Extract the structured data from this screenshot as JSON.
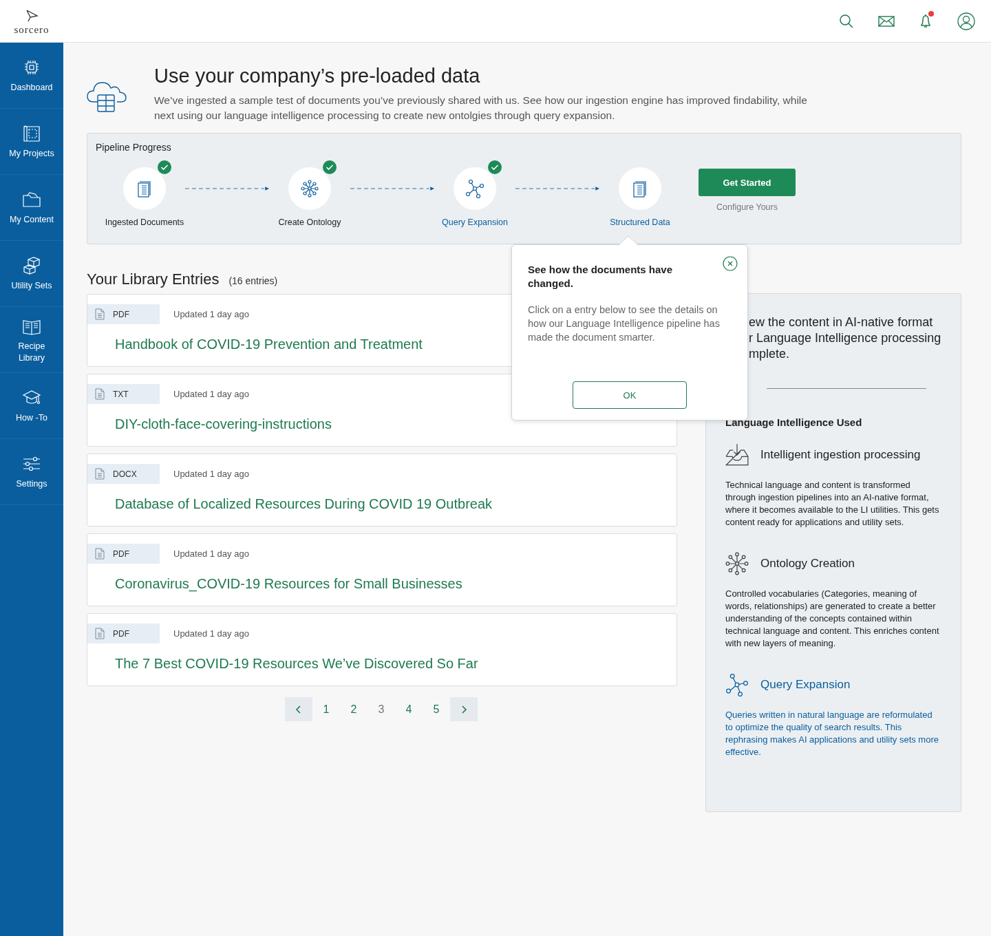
{
  "brand": {
    "name": "sorcero"
  },
  "header_icons": [
    {
      "kind": "search",
      "badge": false
    },
    {
      "kind": "mail",
      "badge": false
    },
    {
      "kind": "bell",
      "badge": true
    },
    {
      "kind": "user",
      "badge": false
    }
  ],
  "sidebar": {
    "items": [
      {
        "label": "Dashboard",
        "kind": "chip"
      },
      {
        "label": "My Projects",
        "kind": "blueprint"
      },
      {
        "label": "My Content",
        "kind": "folder"
      },
      {
        "label": "Utility Sets",
        "kind": "blocks"
      },
      {
        "label": "Recipe Library",
        "kind": "book"
      },
      {
        "label": "How -To",
        "kind": "cap"
      },
      {
        "label": "Settings",
        "kind": "sliders"
      }
    ]
  },
  "intro": {
    "title": "Use your company’s pre-loaded data",
    "text": "We’ve ingested a sample test of documents you’ve previously shared with us. See how our ingestion engine has improved findability, while next using our language intelligence processing to create new ontolgies through query expansion."
  },
  "pipeline": {
    "title": "Pipeline Progress",
    "steps": [
      {
        "label": "Ingested Documents",
        "kind": "document",
        "done": true,
        "active": false
      },
      {
        "label": "Create Ontology",
        "kind": "network",
        "done": true,
        "active": false
      },
      {
        "label": "Query  Expansion",
        "kind": "molecule",
        "done": true,
        "active": true
      },
      {
        "label": "Structured Data",
        "kind": "document",
        "done": false,
        "active": true
      }
    ],
    "button": "Get Started",
    "button_caption": "Configure Yours"
  },
  "library": {
    "title": "Your Library Entries",
    "count": "(16 entries)",
    "entries": [
      {
        "type": "PDF",
        "updated": "Updated  1 day ago",
        "title": "Handbook of COVID-19 Prevention and Treatment"
      },
      {
        "type": "TXT",
        "updated": "Updated  1 day ago",
        "title": "DIY-cloth-face-covering-instructions"
      },
      {
        "type": "DOCX",
        "updated": "Updated  1 day ago",
        "title": "Database of Localized Resources During COVID 19 Outbreak"
      },
      {
        "type": "PDF",
        "updated": "Updated  1 day ago",
        "title": "Coronavirus_COVID-19 Resources for Small Businesses"
      },
      {
        "type": "PDF",
        "updated": "Updated  1 day ago",
        "title": "The 7 Best COVID-19 Resources We’ve Discovered So Far"
      }
    ]
  },
  "pagination": {
    "pages": [
      {
        "label": "1",
        "selected": false
      },
      {
        "label": "2",
        "selected": false
      },
      {
        "label": "3",
        "selected": true
      },
      {
        "label": "4",
        "selected": false
      },
      {
        "label": "5",
        "selected": false
      }
    ]
  },
  "info_panel": {
    "intro_lines": [
      "ew the content in AI-native format",
      "r Language Intelligence processing",
      "mplete."
    ],
    "title": "Language Intelligence Used",
    "items": [
      {
        "kind": "inbox",
        "title": "Intelligent ingestion processing",
        "text": "Technical language and content is transformed through ingestion pipelines into an AI-native format, where it becomes available to the LI utilities. This gets content ready for applications and utility sets.",
        "active": false
      },
      {
        "kind": "network",
        "title": "Ontology Creation",
        "text": "Controlled vocabularies (Categories, meaning of words, relationships) are generated to create a better understanding of the concepts contained within technical language and content. This enriches content with new layers of meaning.",
        "active": false
      },
      {
        "kind": "molecule",
        "title": "Query Expansion",
        "text": "Queries written in natural language are reformulated to optimize the quality of search results. This rephrasing makes AI applications and utility sets more effective.",
        "active": true
      }
    ]
  },
  "popover": {
    "title": "See how the documents have changed.",
    "text": "Click on a entry below to see the details on how our Language Intelligence pipeline has made the document smarter.",
    "button": "OK"
  }
}
